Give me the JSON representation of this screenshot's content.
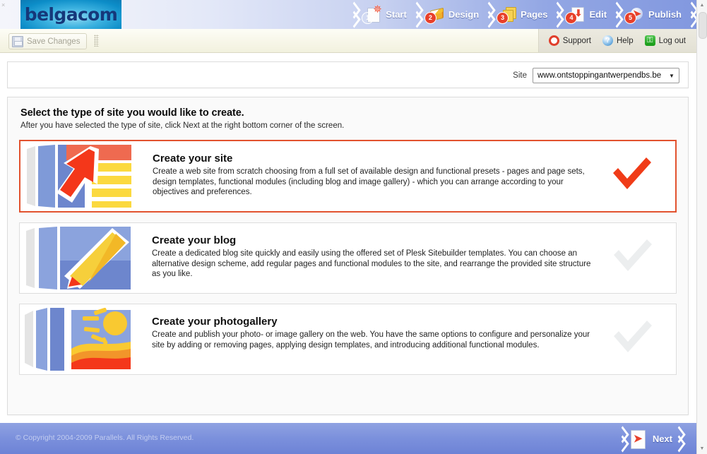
{
  "branding": {
    "logo_text": "belgacom"
  },
  "steps": [
    {
      "num": "1",
      "label": "Start",
      "icon": "start-icon",
      "current": true
    },
    {
      "num": "2",
      "label": "Design",
      "icon": "design-icon",
      "current": false
    },
    {
      "num": "3",
      "label": "Pages",
      "icon": "pages-icon",
      "current": false
    },
    {
      "num": "4",
      "label": "Edit",
      "icon": "edit-icon",
      "current": false
    },
    {
      "num": "5",
      "label": "Publish",
      "icon": "publish-icon",
      "current": false
    }
  ],
  "toolbar": {
    "save_label": "Save Changes",
    "save_icon": "floppy-disk-icon",
    "grip_icon": "drag-handle-icon"
  },
  "utility": [
    {
      "label": "Support",
      "icon": "lifebuoy-icon",
      "glyph": ""
    },
    {
      "label": "Help",
      "icon": "question-mark-icon",
      "glyph": "?"
    },
    {
      "label": "Log out",
      "icon": "key-icon",
      "glyph": "⚿"
    }
  ],
  "site": {
    "label": "Site",
    "selected": "www.ontstoppingantwerpendbs.be",
    "dropdown_icon": "chevron-down-icon",
    "arrow_glyph": "▼"
  },
  "page": {
    "heading": "Select the type of site you would like to create.",
    "subheading": "After you have selected the type of site, click Next at the right bottom corner of the screen."
  },
  "options": [
    {
      "title": "Create your site",
      "description": "Create a web site from scratch choosing from a full set of available design and functional presets - pages and page sets, design templates, functional modules (including blog and image gallery) - which you can arrange according to your objectives and preferences.",
      "thumb_icon": "arrow-site-thumbnail",
      "check_icon": "checkmark-icon",
      "selected": true
    },
    {
      "title": "Create your blog",
      "description": "Create a dedicated blog site quickly and easily using the offered set of Plesk Sitebuilder templates. You can choose an alternative design scheme, add regular pages and functional modules to the site, and rearrange the provided site structure as you like.",
      "thumb_icon": "pencil-blog-thumbnail",
      "check_icon": "checkmark-icon",
      "selected": false
    },
    {
      "title": "Create your photogallery",
      "description": "Create and publish your photo- or image gallery on the web. You have the same options to configure and personalize your site by adding or removing pages, applying design templates, and introducing additional functional modules.",
      "thumb_icon": "sun-photo-thumbnail",
      "check_icon": "checkmark-icon",
      "selected": false
    }
  ],
  "footer": {
    "copyright": "© Copyright 2004-2009 Parallels. All Rights Reserved.",
    "next_label": "Next",
    "next_icon": "next-page-icon"
  },
  "scrollbar": {
    "up_glyph": "▲",
    "down_glyph": "▼"
  },
  "colors": {
    "selected_border": "#e2522e",
    "check_selected": "#f03c18",
    "check_unselected": "#eceeef",
    "header_blue": "#8298df",
    "footer_blue": "#7b90dc",
    "logo_blue": "#0c8dc8"
  }
}
